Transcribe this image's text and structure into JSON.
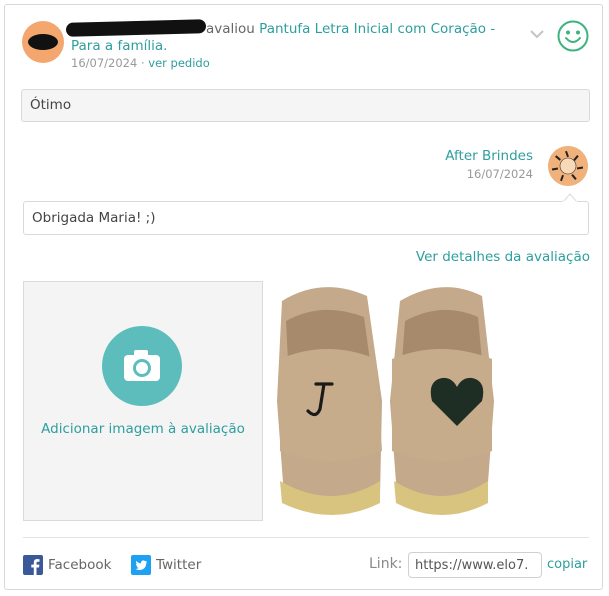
{
  "review": {
    "verb": "avaliou",
    "product_line1": "Pantufa Letra Inicial com Coração -",
    "product_line2": "Para a família.",
    "date": "16/07/2024",
    "separator": "·",
    "view_order": "ver pedido",
    "rating_icon": "happy-face-icon",
    "comment": "Ótimo"
  },
  "reply": {
    "seller_name": "After Brindes",
    "date": "16/07/2024",
    "text": "Obrigada Maria! ;)"
  },
  "actions": {
    "details_link": "Ver detalhes da avaliação",
    "add_image": "Adicionar imagem à avaliação"
  },
  "share": {
    "facebook": "Facebook",
    "twitter": "Twitter",
    "link_label": "Link:",
    "link_value": "https://www.elo7.",
    "copy": "copiar"
  },
  "colors": {
    "accent": "#2e9e9e",
    "camera_circle": "#5dbdbd",
    "smiley": "#3db37f",
    "facebook": "#3b5998",
    "twitter": "#1da1f2"
  }
}
